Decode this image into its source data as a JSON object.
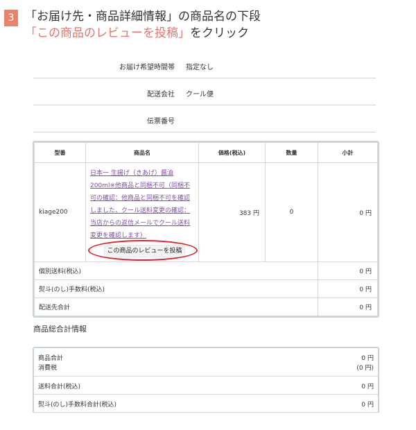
{
  "instruction": {
    "step": "3",
    "line1": "「お届け先・商品詳細情報」の商品名の下段",
    "line2_highlight": "「この商品のレビューを投稿」",
    "line2_rest": "をクリック"
  },
  "delivery": [
    {
      "label": "お届け希望時間帯",
      "value": "指定なし"
    },
    {
      "label": "配送会社",
      "value": "クール便"
    },
    {
      "label": "伝票番号",
      "value": ""
    }
  ],
  "order_table": {
    "headers": [
      "型番",
      "商品名",
      "価格(税込)",
      "数量",
      "小計"
    ],
    "item": {
      "code": "kiage200",
      "name": "日本一 生揚げ（きあげ）醤油200ml※他商品と同梱不可（同梱不可の確認：他商品と同梱不可を確認しました、クール送料変更の確認：当店からの返信メールでクール送料変更を確認します）",
      "price": "383 円",
      "qty": "0",
      "subtotal": "0 円",
      "review_button": "この商品のレビューを投稿"
    },
    "summary": [
      {
        "label": "個別送料(税込)",
        "amount": "0 円"
      },
      {
        "label": "熨斗(のし)手数料(税込)",
        "amount": "0 円"
      },
      {
        "label": "配送先合計",
        "amount": "0 円"
      }
    ]
  },
  "totals": {
    "title": "商品総合計情報",
    "rows": [
      {
        "label": "商品合計",
        "amount": "0 円"
      },
      {
        "label": "消費税",
        "amount": "(0 円)"
      },
      {
        "label": "送料合計(税込)",
        "amount": "0 円"
      },
      {
        "label": "熨斗(のし)手数料合計(税込)",
        "amount": "0 円"
      }
    ]
  },
  "colors": {
    "accent": "#e8836f",
    "highlight_text": "#e8736b",
    "link": "#7f4fa0",
    "annotation_ring": "#d8262e",
    "table_border": "#c9d6ce"
  }
}
